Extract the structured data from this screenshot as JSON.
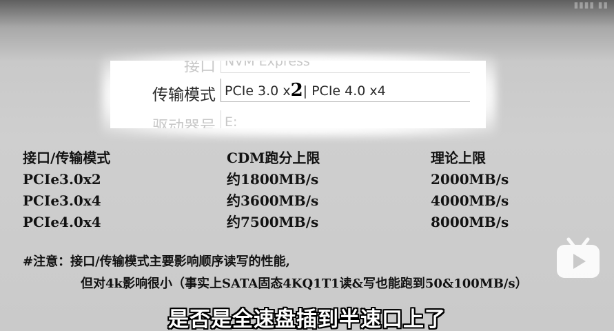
{
  "zoom_panel": {
    "rows": [
      {
        "label": "接口",
        "value": "NVM Express"
      },
      {
        "label": "传输模式",
        "value_pre": "PCIe 3.0 x",
        "value_emph": "2",
        "value_post": "| PCIe 4.0 x4"
      },
      {
        "label": "驱动器号",
        "value": "E:"
      }
    ]
  },
  "table": {
    "headers": [
      "接口/传输模式",
      "CDM跑分上限",
      "理论上限"
    ],
    "rows": [
      [
        "PCIe3.0x2",
        "约1800MB/s",
        "2000MB/s"
      ],
      [
        "PCIe3.0x4",
        "约3600MB/s",
        "4000MB/s"
      ],
      [
        "PCIe4.0x4",
        "约7500MB/s",
        "8000MB/s"
      ]
    ]
  },
  "note": {
    "line1": "#注意：接口/传输模式主要影响顺序读写的性能,",
    "line2": "但对4k影响很小（事实上SATA固态4KQ1T1读&写也能跑到50&100MB/s）"
  },
  "subtitle": "是否是全速盘插到半速口上了",
  "icons": {
    "watermark": "bilibili-tv-icon",
    "watermark_color": "#ffffff"
  }
}
